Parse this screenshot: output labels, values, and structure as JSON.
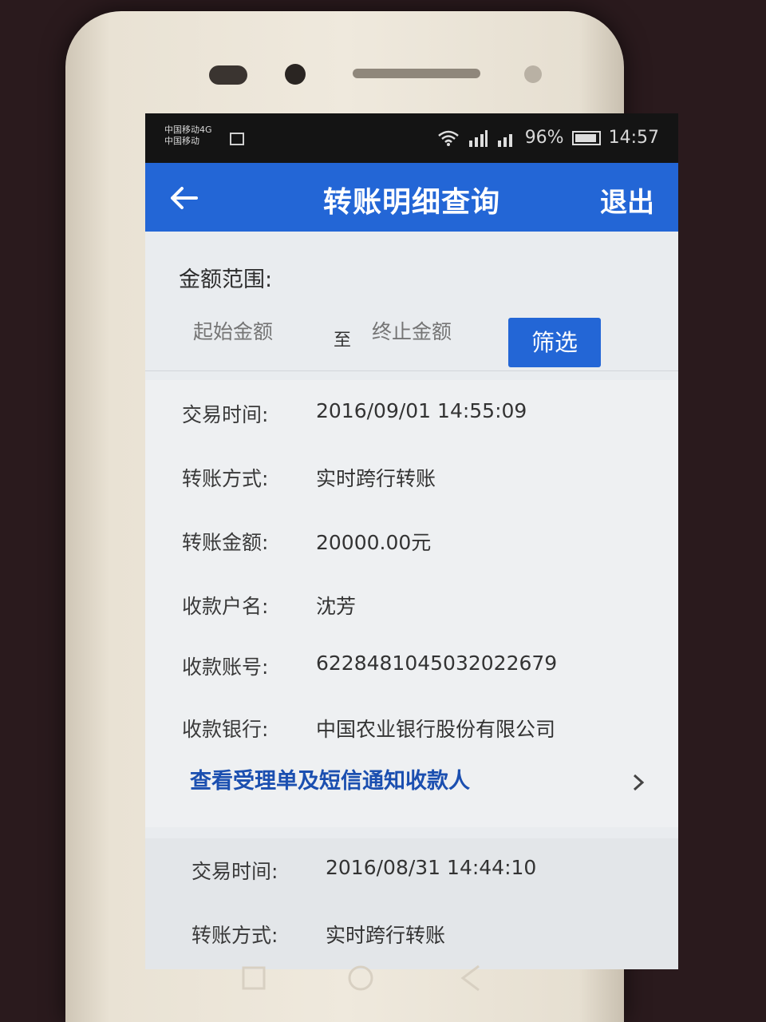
{
  "status_bar": {
    "carrier_line1": "中国移动4G",
    "carrier_line2": "中国移动",
    "battery": "96%",
    "time": "14:57"
  },
  "app_bar": {
    "back_icon": "arrow-left-icon",
    "title": "转账明细查询",
    "logout_label": "退出"
  },
  "filter": {
    "label": "金额范围:",
    "start_placeholder": "起始金额",
    "separator": "至",
    "end_placeholder": "终止金额",
    "button_label": "筛选"
  },
  "records": [
    {
      "time_label": "交易时间:",
      "time_value": "2016/09/01 14:55:09",
      "method_label": "转账方式:",
      "method_value": "实时跨行转账",
      "amount_label": "转账金额:",
      "amount_value": "20000.00元",
      "payee_label": "收款户名:",
      "payee_value": "沈芳",
      "account_label": "收款账号:",
      "account_value": "6228481045032022679",
      "bank_label": "收款银行:",
      "bank_value": "中国农业银行股份有限公司",
      "link": "查看受理单及短信通知收款人"
    },
    {
      "time_label": "交易时间:",
      "time_value": "2016/08/31 14:44:10",
      "method_label": "转账方式:",
      "method_value": "实时跨行转账"
    }
  ],
  "colors": {
    "accent": "#2366d6",
    "link": "#1b4fb0",
    "background": "#e9ecef"
  }
}
